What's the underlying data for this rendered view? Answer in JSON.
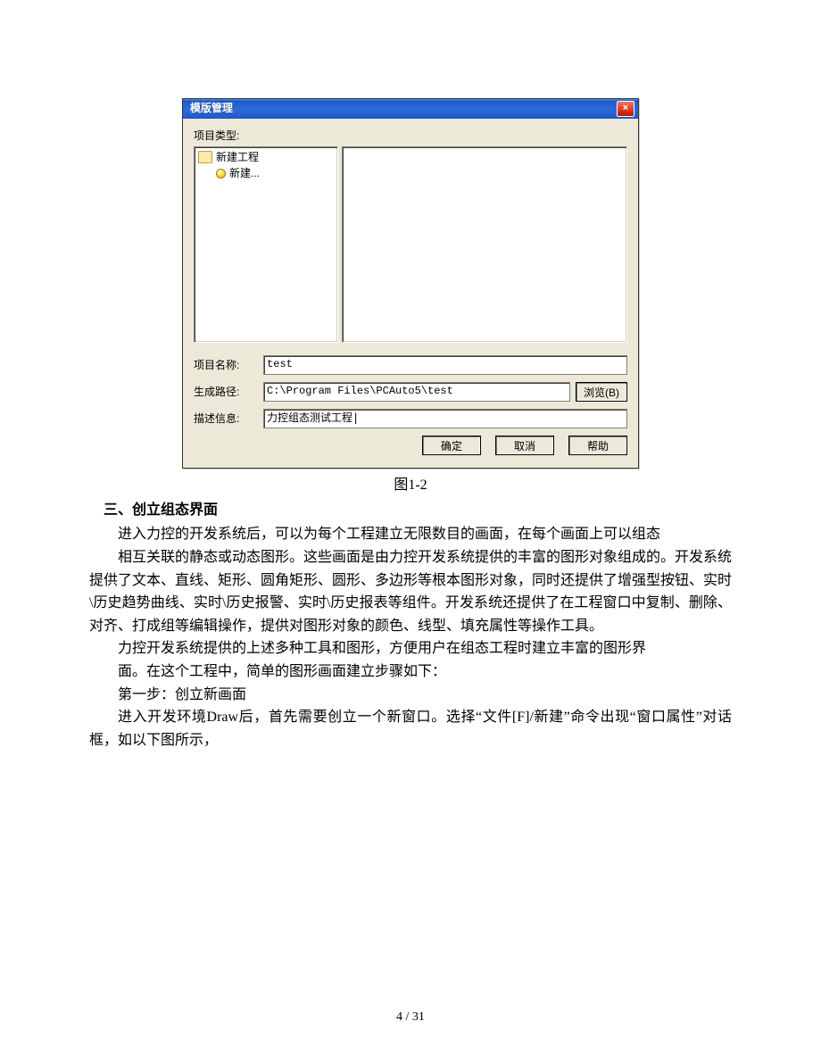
{
  "dialog": {
    "title": "模版管理",
    "close_glyph": "×",
    "group_label": "项目类型:",
    "tree": {
      "root": "新建工程",
      "child": "新建..."
    },
    "labels": {
      "project_name": "项目名称:",
      "gen_path": "生成路径:",
      "desc": "描述信息:"
    },
    "values": {
      "project_name": "test",
      "gen_path": "C:\\Program Files\\PCAuto5\\test",
      "desc": "力控组态测试工程|"
    },
    "buttons": {
      "browse": "浏览(B)",
      "ok": "确定",
      "cancel": "取消",
      "help": "帮助"
    }
  },
  "doc": {
    "caption": "图1-2",
    "section_title": "三、创立组态界面",
    "p1": "进入力控的开发系统后，可以为每个工程建立无限数目的画面，在每个画面上可以组态",
    "p2": "相互关联的静态或动态图形。这些画面是由力控开发系统提供的丰富的图形对象组成的。开发系统提供了文本、直线、矩形、圆角矩形、圆形、多边形等根本图形对象，同时还提供了增强型按钮、实时\\历史趋势曲线、实时\\历史报警、实时\\历史报表等组件。开发系统还提供了在工程窗口中复制、删除、对齐、打成组等编辑操作，提供对图形对象的颜色、线型、填充属性等操作工具。",
    "p3": "力控开发系统提供的上述多种工具和图形，方便用户在组态工程时建立丰富的图形界",
    "p4": "面。在这个工程中，简单的图形画面建立步骤如下：",
    "p5": "第一步：创立新画面",
    "p6": "进入开发环境Draw后，首先需要创立一个新窗口。选择“文件[F]/新建”命令出现“窗口属性”对话框，如以下图所示，"
  },
  "footer": "4 / 31"
}
